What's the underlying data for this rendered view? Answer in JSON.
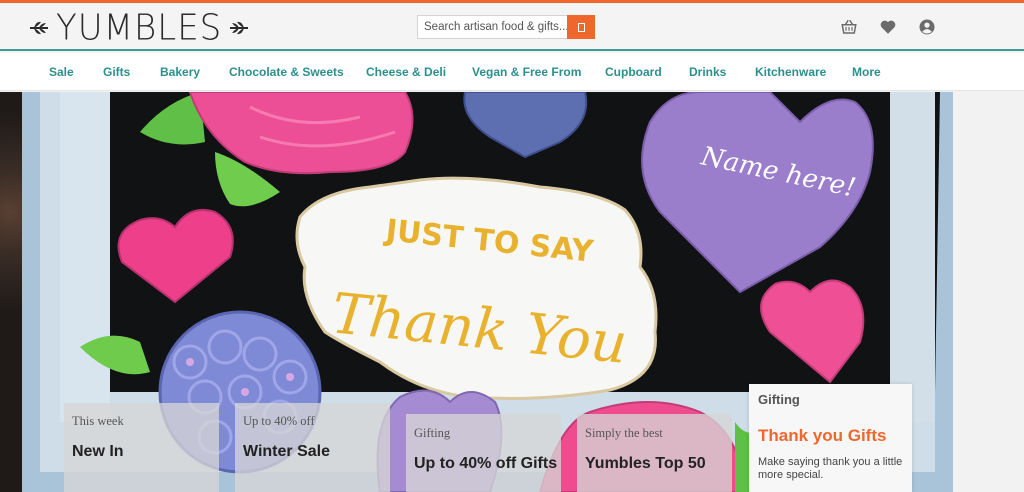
{
  "brand": {
    "logo_text": "YUMBLES",
    "accent": "#f0672d",
    "nav_color": "#2c8f8c"
  },
  "search": {
    "placeholder": "Search artisan food & gifts...",
    "button_icon": "search-icon"
  },
  "header_icons": [
    "basket-icon",
    "heart-icon",
    "account-icon"
  ],
  "nav": {
    "items": [
      {
        "label": "Sale"
      },
      {
        "label": "Gifts"
      },
      {
        "label": "Bakery"
      },
      {
        "label": "Chocolate & Sweets"
      },
      {
        "label": "Cheese & Deli"
      },
      {
        "label": "Vegan & Free From"
      },
      {
        "label": "Cupboard"
      },
      {
        "label": "Drinks"
      },
      {
        "label": "Kitchenware"
      },
      {
        "label": "More"
      }
    ]
  },
  "hero": {
    "cookie_main_line1": "JUST TO SAY",
    "cookie_main_line2": "Thank You",
    "cookie_heart_text": "Name here!"
  },
  "tiles": [
    {
      "kicker": "This week",
      "title": "New In"
    },
    {
      "kicker": "Up to 40% off",
      "title": "Winter Sale"
    },
    {
      "kicker": "Gifting",
      "title": "Up to 40% off Gifts"
    },
    {
      "kicker": "Simply the best",
      "title": "Yumbles Top 50"
    }
  ],
  "featured": {
    "kicker": "Gifting",
    "title": "Thank you Gifts",
    "description": "Make saying thank you a little more special."
  }
}
